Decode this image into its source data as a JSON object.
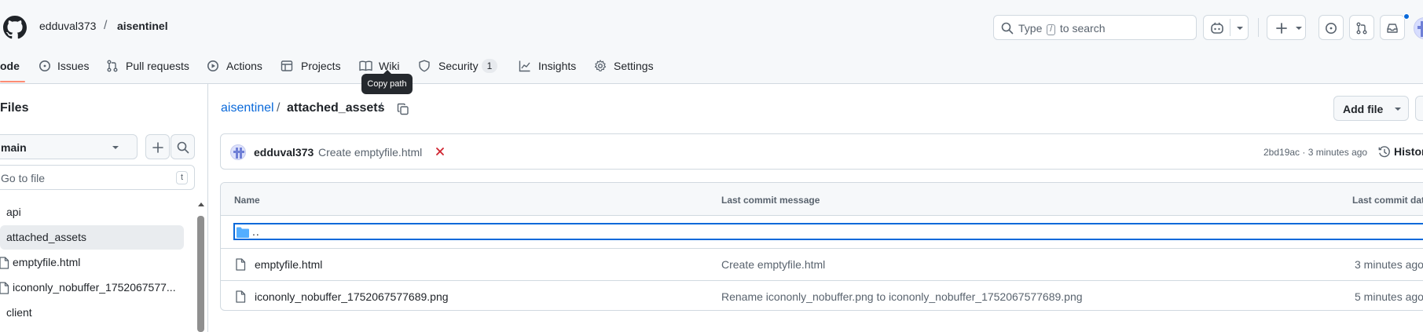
{
  "colors": {
    "accent": "#0969da",
    "header_bg": "#f6f8fa",
    "underline": "#fd8c73",
    "tooltip_bg": "#25292e",
    "danger": "#cf222e"
  },
  "header": {
    "owner": "edduval373",
    "separator": "/",
    "repo": "aisentinel",
    "search": {
      "prefix": "Type",
      "key": "/",
      "suffix": "to search"
    }
  },
  "nav": {
    "code": "ode",
    "issues": "Issues",
    "pull_requests": "Pull requests",
    "actions": "Actions",
    "projects": "Projects",
    "wiki": "Wiki",
    "security": "Security",
    "security_count": "1",
    "insights": "Insights",
    "settings": "Settings"
  },
  "tooltip": "Copy path",
  "sidebar": {
    "title": "Files",
    "branch": "main",
    "goto_placeholder": "Go to file",
    "goto_key": "t",
    "items": [
      {
        "label": "api",
        "type": "dir"
      },
      {
        "label": "attached_assets",
        "type": "dir",
        "selected": true
      },
      {
        "label": "emptyfile.html",
        "type": "file"
      },
      {
        "label": "icononly_nobuffer_1752067577...",
        "type": "file"
      },
      {
        "label": "client",
        "type": "dir"
      }
    ]
  },
  "breadcrumb": {
    "repo": "aisentinel",
    "sep1": "/",
    "dir": "attached_assets",
    "sep2": "/"
  },
  "add_file": "Add file",
  "latest_commit": {
    "author": "edduval373",
    "message": "Create emptyfile.html",
    "status_icon": "x-icon",
    "hash_time": "2bd19ac · 3 minutes ago",
    "history": "History"
  },
  "table": {
    "headers": {
      "name": "Name",
      "message": "Last commit message",
      "date": "Last commit date"
    },
    "parent": "..",
    "rows": [
      {
        "name": "emptyfile.html",
        "message": "Create emptyfile.html",
        "date": "3 minutes ago"
      },
      {
        "name": "icononly_nobuffer_1752067577689.png",
        "message": "Rename icononly_nobuffer.png to icononly_nobuffer_1752067577689.png",
        "date": "5 minutes ago"
      }
    ]
  }
}
